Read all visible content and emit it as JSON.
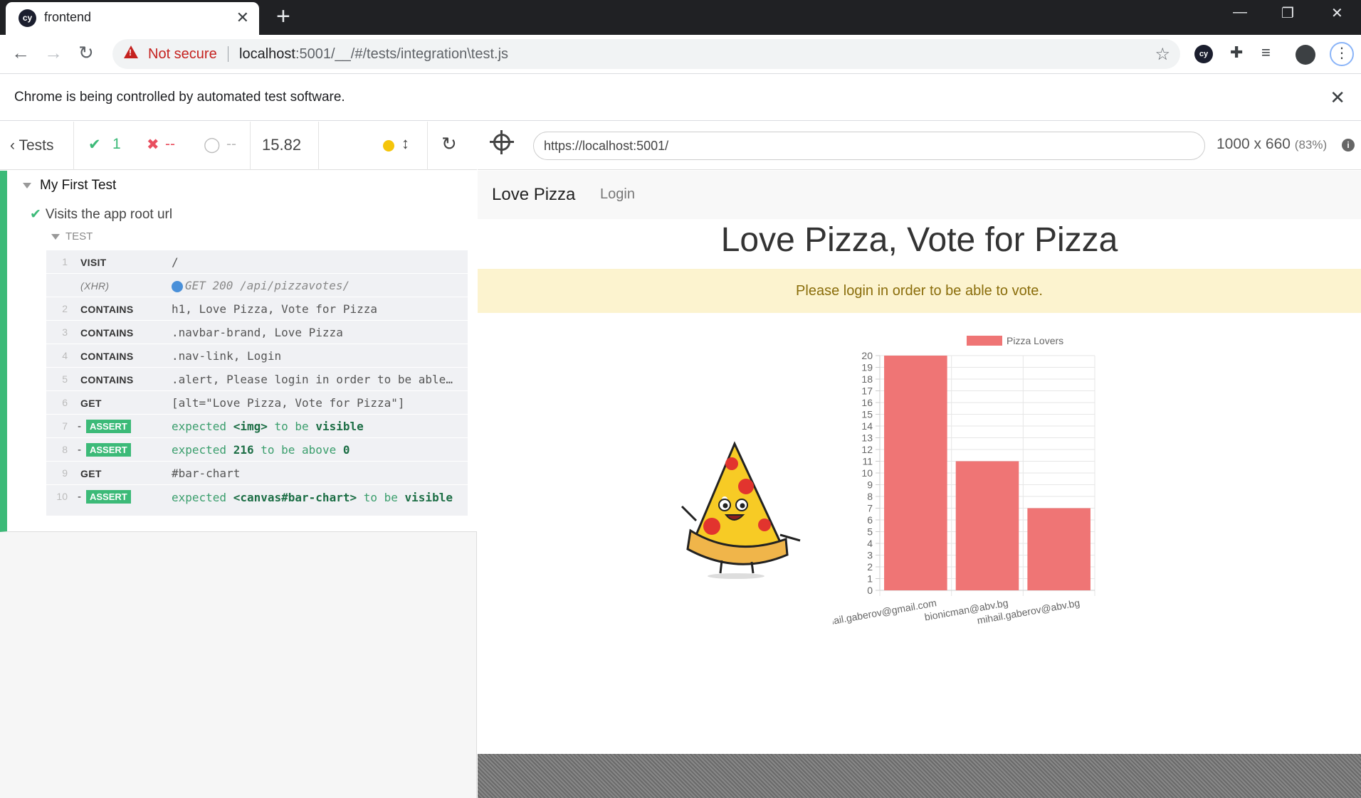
{
  "browser": {
    "tab_title": "frontend",
    "tab_icon": "cy",
    "security_label": "Not secure",
    "url_host": "localhost",
    "url_rest": ":5001/__/#/tests/integration\\test.js",
    "infobar": "Chrome is being controlled by automated test software."
  },
  "runner": {
    "tests_label": "Tests",
    "passed": "1",
    "failed": "--",
    "pending": "--",
    "duration": "15.82",
    "aut_url": "https://localhost:5001/",
    "viewport": "1000 x 660",
    "viewport_scale": "(83%)"
  },
  "reporter": {
    "suite_title": "My First Test",
    "test_title": "Visits the app root url",
    "hook_title": "TEST",
    "commands": [
      {
        "num": "1",
        "name": "VISIT",
        "message": "/",
        "kind": "normal"
      },
      {
        "num": "",
        "name": "(XHR)",
        "message": "GET 200 /api/pizzavotes/",
        "kind": "xhr"
      },
      {
        "num": "2",
        "name": "CONTAINS",
        "message": "h1, Love Pizza, Vote for Pizza",
        "kind": "normal"
      },
      {
        "num": "3",
        "name": "CONTAINS",
        "message": ".navbar-brand, Love Pizza",
        "kind": "normal"
      },
      {
        "num": "4",
        "name": "CONTAINS",
        "message": ".nav-link, Login",
        "kind": "normal"
      },
      {
        "num": "5",
        "name": "CONTAINS",
        "message": ".alert, Please login in order to be able…",
        "kind": "normal"
      },
      {
        "num": "6",
        "name": "GET",
        "message": "[alt=\"Love Pizza, Vote for Pizza\"]",
        "kind": "normal"
      },
      {
        "num": "7",
        "name": "ASSERT",
        "message_parts": [
          "expected ",
          "<img>",
          " to be ",
          "visible"
        ],
        "kind": "assert"
      },
      {
        "num": "8",
        "name": "ASSERT",
        "message_parts": [
          "expected ",
          "216",
          " to be above ",
          "0"
        ],
        "kind": "assert"
      },
      {
        "num": "9",
        "name": "GET",
        "message": "#bar-chart",
        "kind": "normal"
      },
      {
        "num": "10",
        "name": "ASSERT",
        "message_parts": [
          "expected ",
          "<canvas#bar-chart>",
          " to be ",
          "visible"
        ],
        "kind": "assert"
      }
    ]
  },
  "app": {
    "brand": "Love Pizza",
    "login": "Login",
    "heading": "Love Pizza, Vote for Pizza",
    "alert": "Please login in order to be able to vote."
  },
  "chart_data": {
    "type": "bar",
    "categories": [
      "mihail.gaberov@gmail.com",
      "bionicman@abv.bg",
      "mihail.gaberov@abv.bg"
    ],
    "series": [
      {
        "name": "Pizza Lovers",
        "values": [
          20,
          11,
          7
        ],
        "color": "#ef7575"
      }
    ],
    "ylim": [
      0,
      20
    ],
    "yticks": [
      0,
      1,
      2,
      3,
      4,
      5,
      6,
      7,
      8,
      9,
      10,
      11,
      12,
      13,
      14,
      15,
      16,
      17,
      18,
      19,
      20
    ],
    "legend": "top",
    "grid": true
  },
  "colors": {
    "pass": "#3cba78",
    "fail": "#e94f5f",
    "alert_bg": "#fcf3cf",
    "alert_text": "#8a6d0b",
    "bar": "#ef7575"
  }
}
